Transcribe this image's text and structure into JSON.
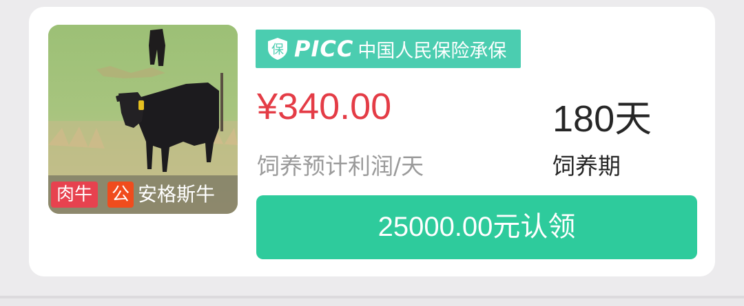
{
  "product": {
    "tags": {
      "type": "肉牛",
      "gender": "公",
      "breed": "安格斯牛"
    },
    "insurance": {
      "icon_char": "保",
      "logo": "PICC",
      "text": "中国人民保险承保"
    },
    "profit_value": "¥340.00",
    "profit_label": "饲养预计利润/天",
    "period_value": "180天",
    "period_label": "饲养期",
    "button_label": "25000.00元认领"
  },
  "colors": {
    "price": "#e43c46",
    "insurance_bg": "#4bcdb0",
    "button_bg": "#2ecb9c",
    "tag_type_bg": "#e7424f",
    "tag_gender_bg": "#f04c1d"
  },
  "icons": {
    "insurance": "shield-icon",
    "photo": "black-angus-cattle-photo"
  }
}
